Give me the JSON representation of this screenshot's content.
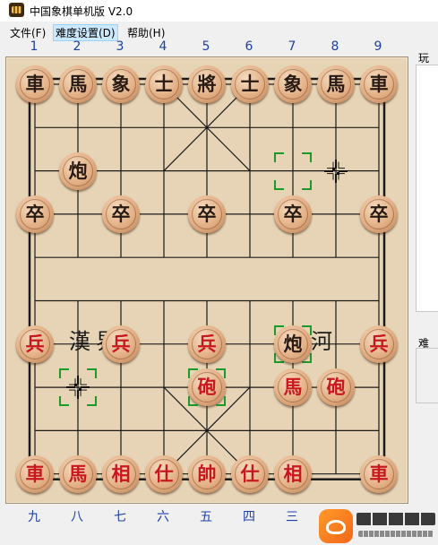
{
  "window": {
    "title": "中国象棋单机版 V2.0"
  },
  "menu": {
    "items": [
      "文件(F)",
      "难度设置(D)",
      "帮助(H)"
    ],
    "active_index": 1
  },
  "board": {
    "columns": 9,
    "rows": 10,
    "column_numbers_top": [
      "1",
      "2",
      "3",
      "4",
      "5",
      "6",
      "7",
      "8",
      "9"
    ],
    "column_numbers_bottom": [
      "九",
      "八",
      "七",
      "六",
      "五",
      "四",
      "三",
      "",
      ""
    ],
    "river_left": "漢界",
    "river_right": "楚河",
    "colors": {
      "board": "#e7d4b6",
      "line": "#1a1a1a",
      "black_text": "#2a1a14",
      "red_text": "#c8181e",
      "selection": "#1a9a28",
      "numbers": "#1f40a0"
    },
    "pieces": [
      {
        "side": "black",
        "char": "車",
        "col": 0,
        "row": 0
      },
      {
        "side": "black",
        "char": "馬",
        "col": 1,
        "row": 0
      },
      {
        "side": "black",
        "char": "象",
        "col": 2,
        "row": 0
      },
      {
        "side": "black",
        "char": "士",
        "col": 3,
        "row": 0
      },
      {
        "side": "black",
        "char": "將",
        "col": 4,
        "row": 0
      },
      {
        "side": "black",
        "char": "士",
        "col": 5,
        "row": 0
      },
      {
        "side": "black",
        "char": "象",
        "col": 6,
        "row": 0
      },
      {
        "side": "black",
        "char": "馬",
        "col": 7,
        "row": 0
      },
      {
        "side": "black",
        "char": "車",
        "col": 8,
        "row": 0
      },
      {
        "side": "black",
        "char": "炮",
        "col": 1,
        "row": 2
      },
      {
        "side": "black",
        "char": "卒",
        "col": 0,
        "row": 3
      },
      {
        "side": "black",
        "char": "卒",
        "col": 2,
        "row": 3
      },
      {
        "side": "black",
        "char": "卒",
        "col": 4,
        "row": 3
      },
      {
        "side": "black",
        "char": "卒",
        "col": 6,
        "row": 3
      },
      {
        "side": "black",
        "char": "卒",
        "col": 8,
        "row": 3
      },
      {
        "side": "black",
        "char": "炮",
        "col": 6,
        "row": 6
      },
      {
        "side": "red",
        "char": "兵",
        "col": 0,
        "row": 6
      },
      {
        "side": "red",
        "char": "兵",
        "col": 2,
        "row": 6
      },
      {
        "side": "red",
        "char": "兵",
        "col": 4,
        "row": 6
      },
      {
        "side": "red",
        "char": "兵",
        "col": 8,
        "row": 6
      },
      {
        "side": "red",
        "char": "砲",
        "col": 4,
        "row": 7
      },
      {
        "side": "red",
        "char": "馬",
        "col": 6,
        "row": 7
      },
      {
        "side": "red",
        "char": "砲",
        "col": 7,
        "row": 7
      },
      {
        "side": "red",
        "char": "車",
        "col": 0,
        "row": 9
      },
      {
        "side": "red",
        "char": "馬",
        "col": 1,
        "row": 9
      },
      {
        "side": "red",
        "char": "相",
        "col": 2,
        "row": 9
      },
      {
        "side": "red",
        "char": "仕",
        "col": 3,
        "row": 9
      },
      {
        "side": "red",
        "char": "帥",
        "col": 4,
        "row": 9
      },
      {
        "side": "red",
        "char": "仕",
        "col": 5,
        "row": 9
      },
      {
        "side": "red",
        "char": "相",
        "col": 6,
        "row": 9
      },
      {
        "side": "red",
        "char": "車",
        "col": 8,
        "row": 9
      }
    ],
    "last_move_markers": [
      {
        "col": 6,
        "row": 2
      },
      {
        "col": 6,
        "row": 6
      }
    ],
    "selection_markers": [
      {
        "col": 1,
        "row": 7
      },
      {
        "col": 4,
        "row": 7
      }
    ],
    "cursors": [
      {
        "col": 7,
        "row": 2
      },
      {
        "col": 1,
        "row": 7
      }
    ]
  },
  "side_panel": {
    "label_top": "玩",
    "label_bottom": "难"
  },
  "watermark": {
    "text": "启东安卓网",
    "url": "www.qdltxz.com"
  }
}
